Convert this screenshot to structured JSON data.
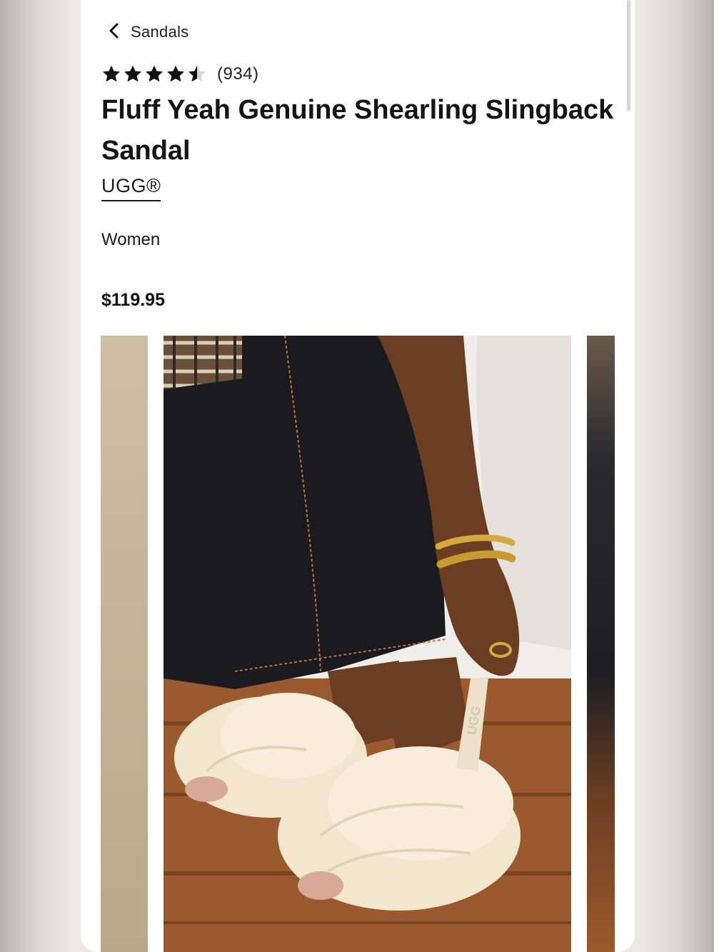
{
  "nav": {
    "back_label": "Sandals"
  },
  "product": {
    "rating": 4.5,
    "review_count": "(934)",
    "title": "Fluff Yeah Genuine Shearling Slingback Sandal",
    "brand": "UGG®",
    "gender": "Women",
    "price": "$119.95"
  },
  "gallery": {
    "images": [
      "product-photo-previous",
      "product-photo-main",
      "product-photo-next"
    ],
    "main_image_text": "UGG"
  },
  "colors": {
    "star_fill": "#111111",
    "star_empty": "#cfd8dc",
    "text": "#141414"
  }
}
